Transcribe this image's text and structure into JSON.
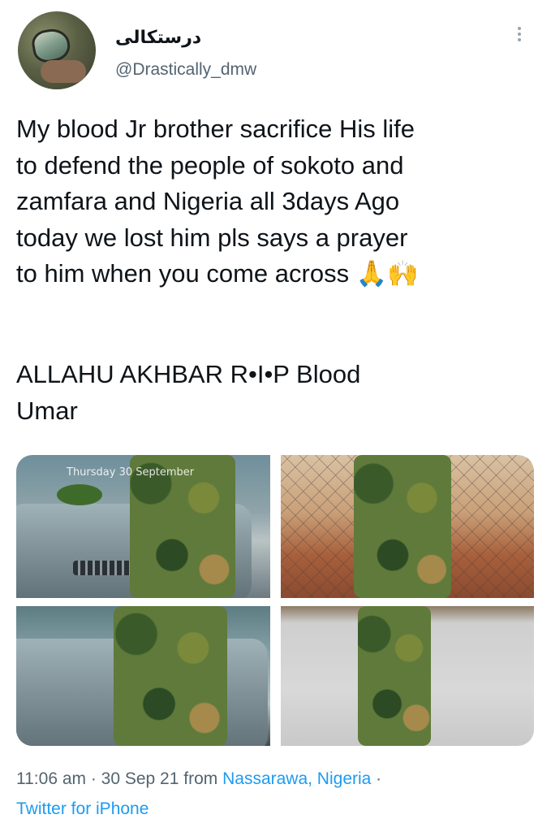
{
  "author": {
    "display_name": "درستکالی",
    "handle": "@Drastically_dmw"
  },
  "tweet": {
    "body": "My blood Jr brother sacrifice His life\nto defend the people of sokoto and\nzamfara and Nigeria all 3days Ago\ntoday we lost him pls says a prayer\nto him when you come across 🙏🙌",
    "body2": "ALLAHU AKHBAR  R•I•P Blood\nUmar"
  },
  "media": {
    "overlay_caption": "Thursday 30 September"
  },
  "meta": {
    "time": "11:06 am · 30 Sep 21 from",
    "location": "Nassarawa, Nigeria",
    "separator": " ·",
    "source": "Twitter for iPhone"
  }
}
